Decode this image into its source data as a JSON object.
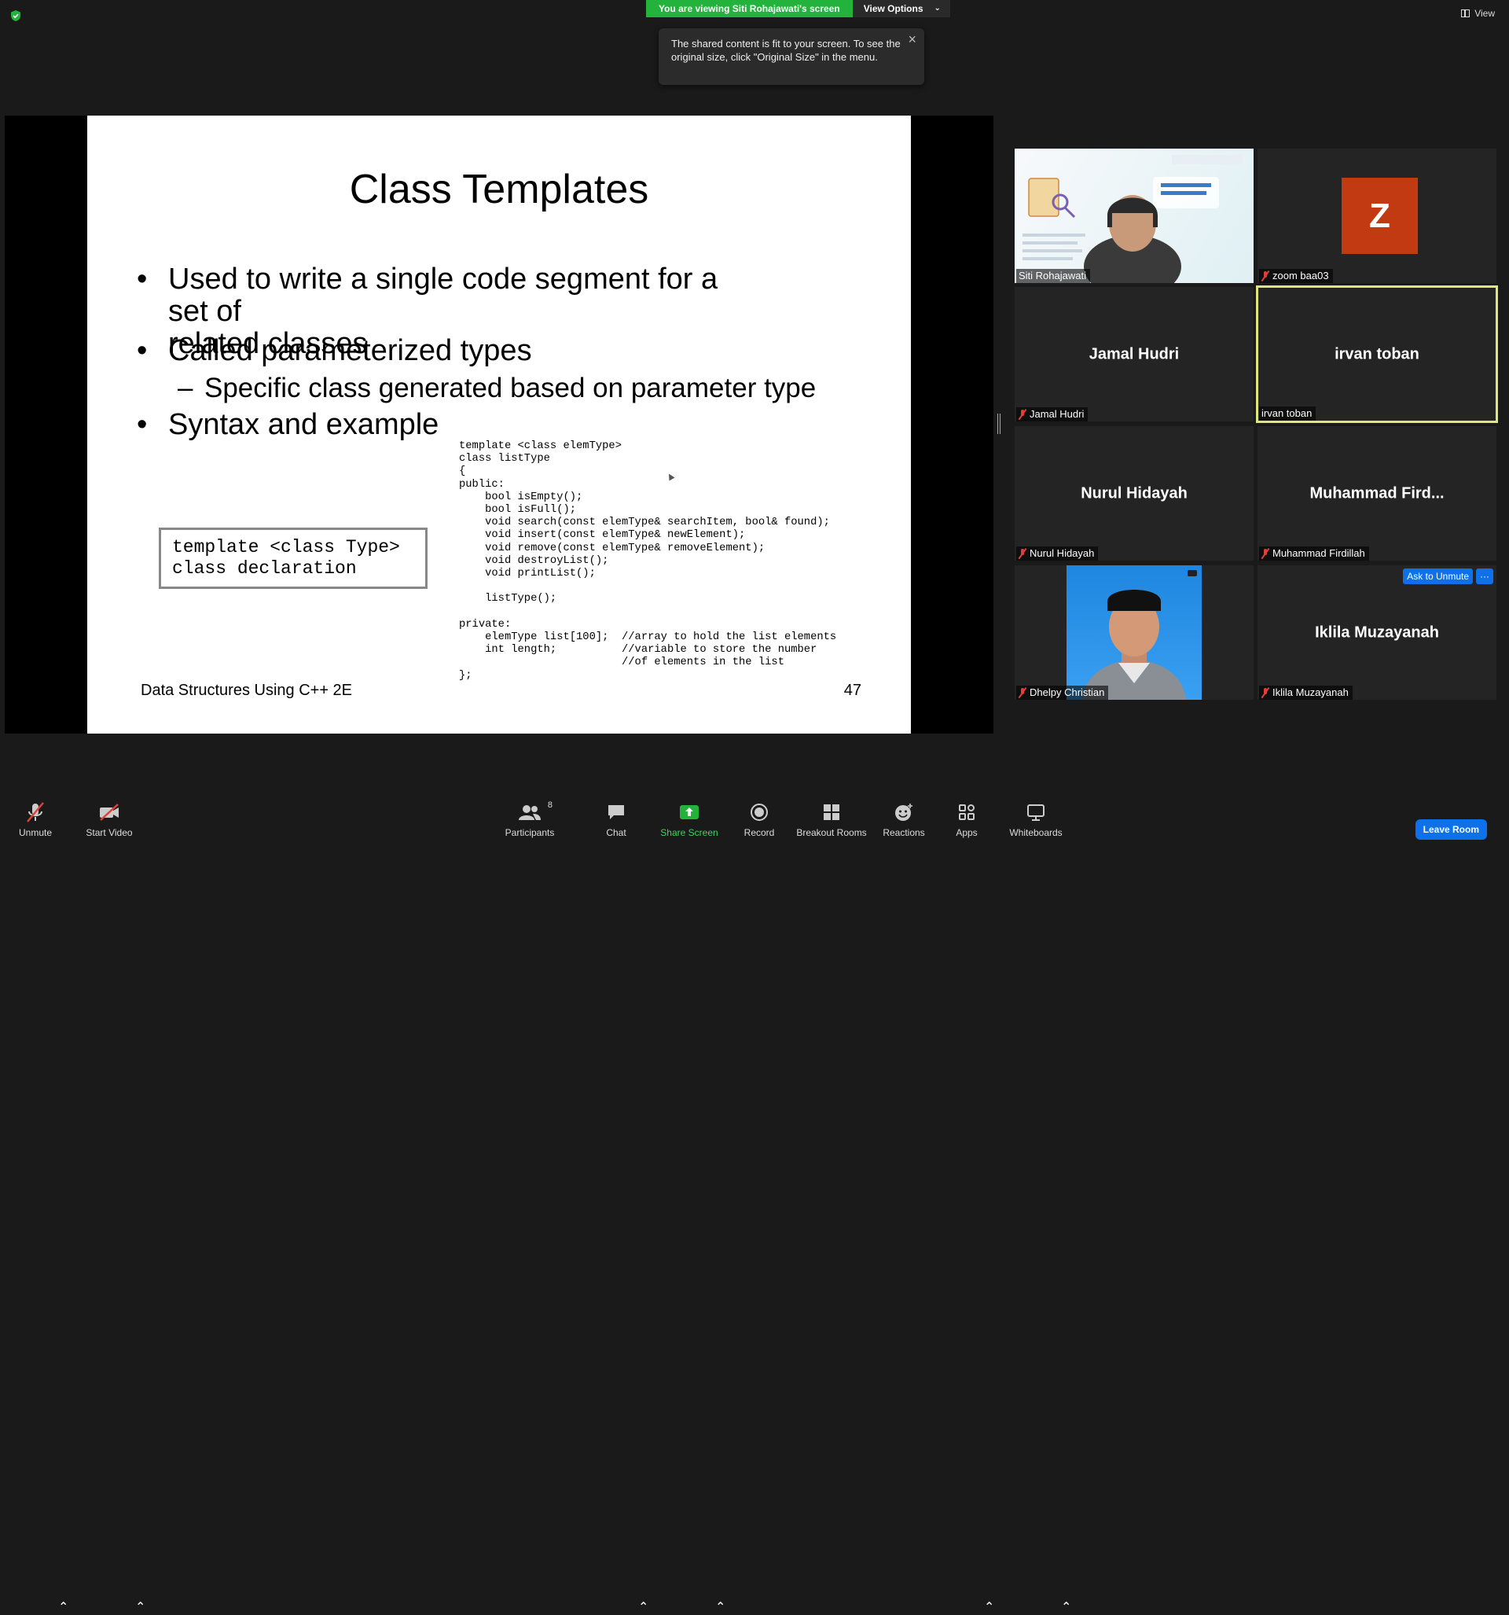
{
  "banner": {
    "viewing_text": "You are viewing Siti Rohajawati's screen",
    "view_options": "View Options"
  },
  "top_right": {
    "view_label": "View"
  },
  "tooltip": {
    "text": "The shared content is fit to your screen. To see the original size, click \"Original Size\" in the menu."
  },
  "slide": {
    "title": "Class Templates",
    "bullet1_line1": "Used to write a single code segment for a set of",
    "bullet1_line2": "related classes",
    "bullet2": "Called parameterized types",
    "sub1": "Specific class generated based on parameter type",
    "bullet3": "Syntax and example",
    "bullet_char": "•",
    "dash_char": "–",
    "syntax": "template <class Type>\nclass declaration",
    "code": "template <class elemType>\nclass listType\n{\npublic:\n    bool isEmpty();\n    bool isFull();\n    void search(const elemType& searchItem, bool& found);\n    void insert(const elemType& newElement);\n    void remove(const elemType& removeElement);\n    void destroyList();\n    void printList();\n\n    listType();\n\nprivate:\n    elemType list[100];  //array to hold the list elements\n    int length;          //variable to store the number\n                         //of elements in the list\n};",
    "footer_left": "Data Structures Using C++ 2E",
    "page_number": "47"
  },
  "participants": [
    {
      "name": "Siti Rohajawati",
      "muted": false,
      "video": true
    },
    {
      "name": "zoom baa03",
      "muted": true,
      "avatar_letter": "Z",
      "avatar_color": "#c23a12"
    },
    {
      "name": "Jamal Hudri",
      "muted": true
    },
    {
      "name": "irvan toban",
      "muted": false,
      "active_speaker": true
    },
    {
      "name": "Nurul Hidayah",
      "muted": true
    },
    {
      "display": "Muhammad  Fird...",
      "name": "Muhammad Firdillah",
      "muted": true
    },
    {
      "name": "Dhelpy Christian",
      "muted": true,
      "video": true
    },
    {
      "name": "Iklila Muzayanah",
      "muted": true
    }
  ],
  "tile_actions": {
    "ask_to_unmute": "Ask to Unmute",
    "more": "···"
  },
  "toolbar": {
    "unmute": "Unmute",
    "start_video": "Start Video",
    "participants": "Participants",
    "participants_count": "8",
    "chat": "Chat",
    "share_screen": "Share Screen",
    "record": "Record",
    "breakout_rooms": "Breakout Rooms",
    "reactions": "Reactions",
    "apps": "Apps",
    "whiteboards": "Whiteboards",
    "leave": "Leave Room"
  },
  "colors": {
    "banner_green": "#23b33c",
    "accent_blue": "#0e71eb",
    "active_speaker_border": "#dce67a",
    "muted_red": "#e0403a"
  }
}
